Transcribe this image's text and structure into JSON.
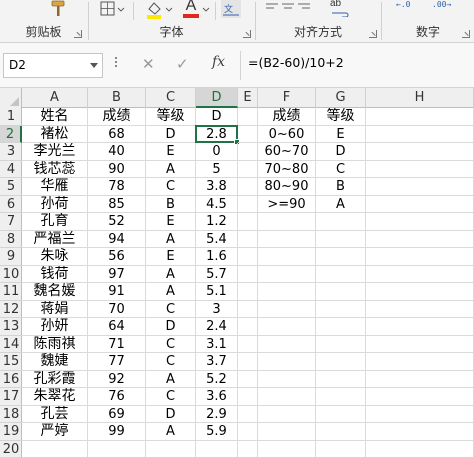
{
  "ribbon": {
    "groups": [
      {
        "label": "剪贴板"
      },
      {
        "label": "字体"
      },
      {
        "label": "对齐方式"
      },
      {
        "label": "数字"
      }
    ],
    "font_color_letter": "A",
    "wrap_label": "ab",
    "decimal_more": "←.0",
    "decimal_less": ".00→"
  },
  "formula_bar": {
    "name_box": "D2",
    "cancel_symbol": "✕",
    "enter_symbol": "✓",
    "fx_label": "fx",
    "formula": "=(B2-60)/10+2"
  },
  "grid": {
    "columns": [
      "A",
      "B",
      "C",
      "D",
      "E",
      "F",
      "G",
      "H"
    ],
    "rows": [
      "1",
      "2",
      "3",
      "4",
      "5",
      "6",
      "7",
      "8",
      "9",
      "10",
      "11",
      "12",
      "13",
      "14",
      "15",
      "16",
      "17",
      "18",
      "19",
      "20"
    ],
    "active_cell": "D2",
    "data": [
      [
        "姓名",
        "成绩",
        "等级",
        "D",
        "",
        "成绩",
        "等级",
        ""
      ],
      [
        "褚松",
        "68",
        "D",
        "2.8",
        "",
        "0~60",
        "E",
        ""
      ],
      [
        "李光兰",
        "40",
        "E",
        "0",
        "",
        "60~70",
        "D",
        ""
      ],
      [
        "钱芯蕊",
        "90",
        "A",
        "5",
        "",
        "70~80",
        "C",
        ""
      ],
      [
        "华雁",
        "78",
        "C",
        "3.8",
        "",
        "80~90",
        "B",
        ""
      ],
      [
        "孙荷",
        "85",
        "B",
        "4.5",
        "",
        ">=90",
        "A",
        ""
      ],
      [
        "孔育",
        "52",
        "E",
        "1.2",
        "",
        "",
        "",
        ""
      ],
      [
        "严福兰",
        "94",
        "A",
        "5.4",
        "",
        "",
        "",
        ""
      ],
      [
        "朱咏",
        "56",
        "E",
        "1.6",
        "",
        "",
        "",
        ""
      ],
      [
        "钱荷",
        "97",
        "A",
        "5.7",
        "",
        "",
        "",
        ""
      ],
      [
        "魏名媛",
        "91",
        "A",
        "5.1",
        "",
        "",
        "",
        ""
      ],
      [
        "蒋娟",
        "70",
        "C",
        "3",
        "",
        "",
        "",
        ""
      ],
      [
        "孙妍",
        "64",
        "D",
        "2.4",
        "",
        "",
        "",
        ""
      ],
      [
        "陈雨祺",
        "71",
        "C",
        "3.1",
        "",
        "",
        "",
        ""
      ],
      [
        "魏婕",
        "77",
        "C",
        "3.7",
        "",
        "",
        "",
        ""
      ],
      [
        "孔彩霞",
        "92",
        "A",
        "5.2",
        "",
        "",
        "",
        ""
      ],
      [
        "朱翠花",
        "76",
        "C",
        "3.6",
        "",
        "",
        "",
        ""
      ],
      [
        "孔芸",
        "69",
        "D",
        "2.9",
        "",
        "",
        "",
        ""
      ],
      [
        "严婷",
        "99",
        "A",
        "5.9",
        "",
        "",
        "",
        ""
      ],
      [
        "",
        "",
        "",
        "",
        "",
        "",
        "",
        ""
      ]
    ]
  },
  "colors": {
    "accent_green": "#217346",
    "font_color_red": "#e0281e",
    "fill_yellow": "#ffe800"
  }
}
